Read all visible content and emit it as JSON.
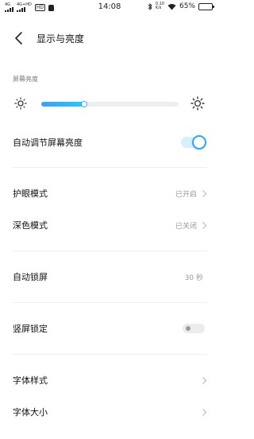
{
  "status_bar": {
    "sim1_label": "4G",
    "sim2_label": "4G+HD",
    "hd_label": "HD",
    "time": "14:08",
    "net_speed_value": "0.10",
    "net_speed_unit": "K/s",
    "battery_percent": "65%",
    "battery_level": 0.65
  },
  "header": {
    "title": "显示与亮度"
  },
  "brightness": {
    "section_label": "屏幕亮度",
    "level": 0.31
  },
  "settings": {
    "auto_brightness": {
      "label": "自动调节屏幕亮度",
      "on": true
    },
    "eye_protection": {
      "label": "护眼模式",
      "value": "已开启"
    },
    "dark_mode": {
      "label": "深色模式",
      "value": "已关闭"
    },
    "auto_lock": {
      "label": "自动锁屏",
      "value": "30 秒"
    },
    "portrait_lock": {
      "label": "竖屏锁定",
      "on": false
    },
    "font_style": {
      "label": "字体样式"
    },
    "font_size": {
      "label": "字体大小"
    }
  },
  "colors": {
    "accent": "#22aaff",
    "slider_fill_start": "#3aa0ff",
    "slider_fill_end": "#22c9ff"
  }
}
